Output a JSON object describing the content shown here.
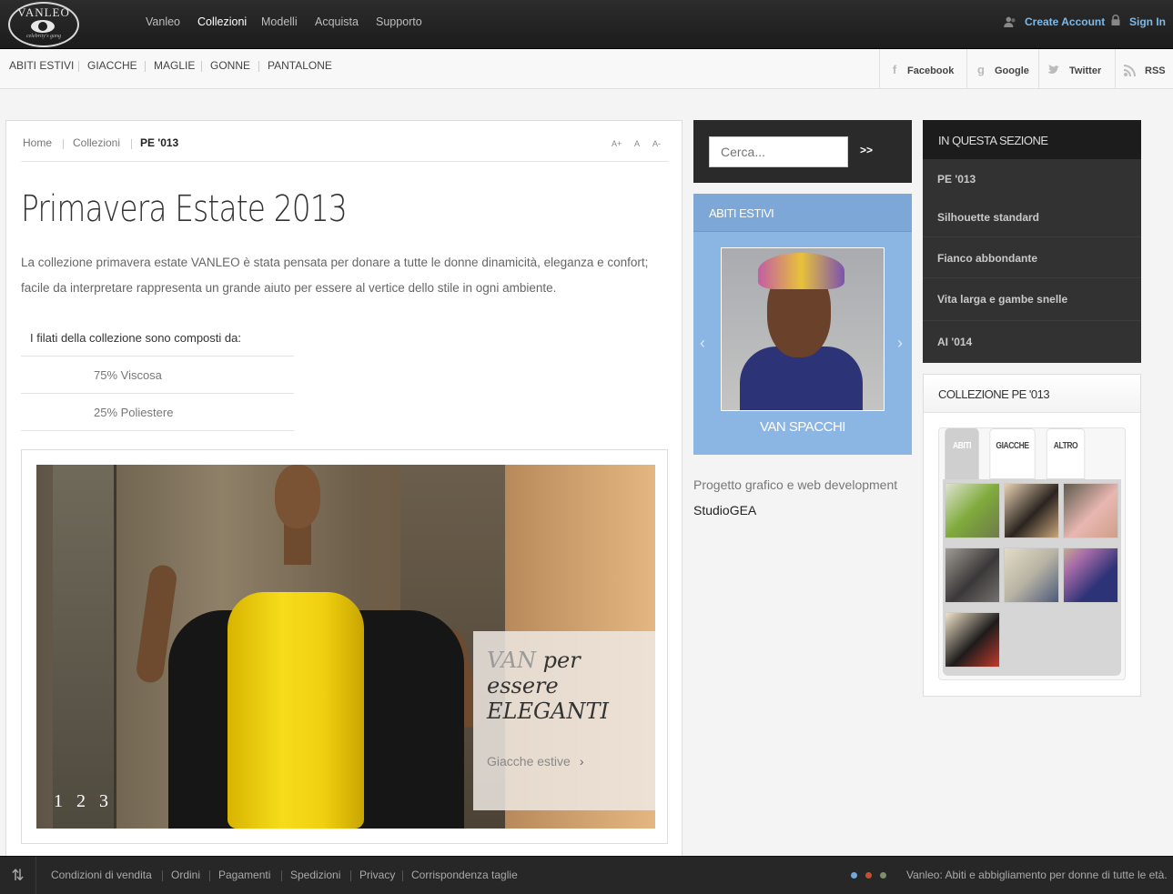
{
  "brand": {
    "name": "VANLEO",
    "tagline": "celebrity's gang"
  },
  "main_nav": [
    {
      "label": "Vanleo",
      "active": false
    },
    {
      "label": "Collezioni",
      "active": true
    },
    {
      "label": "Modelli",
      "active": false
    },
    {
      "label": "Acquista",
      "active": false
    },
    {
      "label": "Supporto",
      "active": false
    }
  ],
  "account": {
    "create": "Create Account",
    "signin": "Sign In"
  },
  "categories": [
    "ABITI ESTIVI",
    "GIACCHE",
    "MAGLIE",
    "GONNE",
    "PANTALONE"
  ],
  "social": [
    {
      "label": "Facebook",
      "icon": "facebook-icon"
    },
    {
      "label": "Google",
      "icon": "google-icon"
    },
    {
      "label": "Twitter",
      "icon": "twitter-icon"
    },
    {
      "label": "RSS",
      "icon": "rss-icon"
    }
  ],
  "breadcrumb": [
    "Home",
    "Collezioni",
    "PE '013"
  ],
  "font_size": [
    "A+",
    "A",
    "A-"
  ],
  "page": {
    "title": "Primavera Estate 2013",
    "intro": "La collezione primavera estate VANLEO è stata pensata per donare a tutte le donne dinamicità, eleganza e confort; facile da interpretare rappresenta un grande aiuto per essere al vertice dello stile in ogni ambiente.",
    "table_header": "I filati della collezione sono composti da:",
    "table_rows": [
      "75% Viscosa",
      "25% Poliestere"
    ]
  },
  "slider": {
    "caption_van": "VAN",
    "caption_rest": " per essere ELEGANTI",
    "link": "Giacche estive",
    "pages": [
      "1",
      "2",
      "3"
    ]
  },
  "search": {
    "placeholder": "Cerca...",
    "button": ">>"
  },
  "abiti_widget": {
    "title": "ABITI ESTIVI",
    "caption": "VAN SPACCHI"
  },
  "credit": {
    "line1": "Progetto grafico e web development",
    "line2": "StudioGEA"
  },
  "section_menu": {
    "title": "IN QUESTA SEZIONE",
    "items": [
      "PE '013",
      "Silhouette standard",
      "Fianco abbondante",
      "Vita larga e gambe snelle",
      "AI '014"
    ]
  },
  "collection": {
    "title": "COLLEZIONE PE '013",
    "tabs": [
      "ABITI",
      "GIACCHE",
      "ALTRO"
    ]
  },
  "footer": {
    "links": [
      "Condizioni di vendita",
      "Ordini",
      "Pagamenti",
      "Spedizioni",
      "Privacy",
      "Corrispondenza taglie"
    ],
    "tagline": "Vanleo: Abiti e abbigliamento per donne di tutte le età.",
    "dot_colors": [
      "#6fa8dc",
      "#c0502f",
      "#7d8f6a"
    ]
  },
  "colors": {
    "accent": "#7fb9e8",
    "widget_blue": "#8bb6e4",
    "dark": "#2a2a2a"
  }
}
